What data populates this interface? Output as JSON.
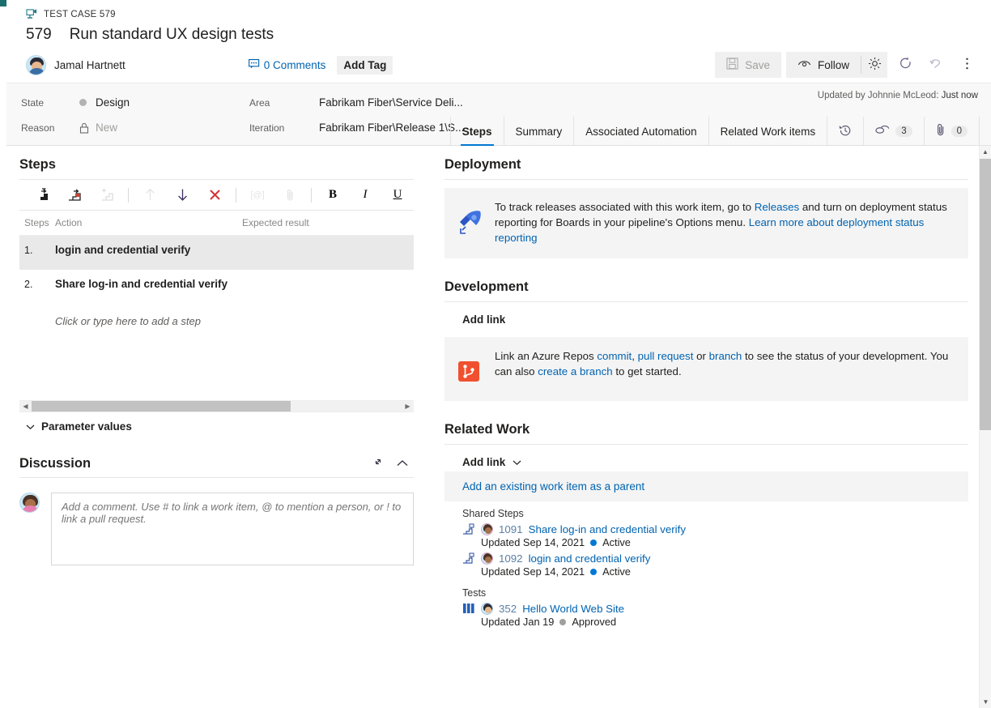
{
  "header": {
    "breadcrumb": "TEST CASE 579",
    "work_item_id": "579",
    "title": "Run standard UX design tests",
    "assignee": "Jamal Hartnett",
    "comments_label": "0 Comments",
    "add_tag_label": "Add Tag",
    "save_label": "Save",
    "follow_label": "Follow",
    "updated_by": "Updated by Johnnie McLeod:",
    "updated_when": "Just now"
  },
  "fields": {
    "state_label": "State",
    "state_value": "Design",
    "reason_label": "Reason",
    "reason_value": "New",
    "area_label": "Area",
    "area_value": "Fabrikam Fiber\\Service Deli...",
    "iteration_label": "Iteration",
    "iteration_value": "Fabrikam Fiber\\Release 1\\S..."
  },
  "tabs": [
    {
      "label": "Steps",
      "active": true
    },
    {
      "label": "Summary",
      "active": false
    },
    {
      "label": "Associated Automation",
      "active": false
    },
    {
      "label": "Related Work items",
      "active": false
    }
  ],
  "tab_icons": {
    "history_icon": "history-icon",
    "links_icon": "links-icon",
    "links_count": "3",
    "attachments_icon": "attachment-icon",
    "attachments_count": "0"
  },
  "steps": {
    "section_title": "Steps",
    "toolbar": [
      {
        "name": "insert-step-icon",
        "enabled": true
      },
      {
        "name": "insert-shared-step-icon",
        "enabled": true
      },
      {
        "name": "create-shared-step-icon",
        "enabled": false
      },
      {
        "name": "move-up-icon",
        "enabled": false
      },
      {
        "name": "move-down-icon",
        "enabled": true
      },
      {
        "name": "delete-icon",
        "enabled": true
      },
      {
        "name": "mention-icon",
        "enabled": false
      },
      {
        "name": "attach-icon",
        "enabled": false
      },
      {
        "name": "bold-icon",
        "enabled": true
      },
      {
        "name": "italic-icon",
        "enabled": true
      },
      {
        "name": "underline-icon",
        "enabled": true
      }
    ],
    "columns": {
      "steps": "Steps",
      "action": "Action",
      "expected": "Expected result"
    },
    "rows": [
      {
        "num": "1.",
        "action": "login and credential verify",
        "expected": "",
        "selected": true
      },
      {
        "num": "2.",
        "action": "Share log-in and credential verify",
        "expected": "",
        "selected": false
      }
    ],
    "add_step_hint": "Click or type here to add a step",
    "parameter_values_label": "Parameter values"
  },
  "discussion": {
    "title": "Discussion",
    "placeholder": "Add a comment. Use # to link a work item, @ to mention a person, or ! to link a pull request."
  },
  "deployment": {
    "title": "Deployment",
    "text_1": "To track releases associated with this work item, go to ",
    "link_releases": "Releases",
    "text_2": " and turn on deployment status reporting for Boards in your pipeline's Options menu. ",
    "link_learn": "Learn more about deployment status reporting"
  },
  "development": {
    "title": "Development",
    "add_link_label": "Add link",
    "text_1": "Link an Azure Repos ",
    "link_commit": "commit",
    "text_sep1": ", ",
    "link_pr": "pull request",
    "text_2": " or ",
    "link_branch": "branch",
    "text_3": " to see the status of your development. You can also ",
    "link_create_branch": "create a branch",
    "text_4": " to get started."
  },
  "related_work": {
    "title": "Related Work",
    "add_link_label": "Add link",
    "parent_banner": "Add an existing work item as a parent",
    "groups": [
      {
        "label": "Shared Steps",
        "items": [
          {
            "icon": "shared-steps-icon",
            "id": "1091",
            "name": "Share log-in and credential verify",
            "updated": "Updated Sep 14, 2021",
            "status": "Active",
            "status_color": "#0078d4"
          },
          {
            "icon": "shared-steps-icon",
            "id": "1092",
            "name": "login and credential verify",
            "updated": "Updated Sep 14, 2021",
            "status": "Active",
            "status_color": "#0078d4"
          }
        ]
      },
      {
        "label": "Tests",
        "items": [
          {
            "icon": "test-plan-icon",
            "id": "352",
            "name": "Hello World Web Site",
            "updated": "Updated Jan 19",
            "status": "Approved",
            "status_color": "#a19f9d"
          }
        ]
      }
    ]
  },
  "colors": {
    "accent_bar": "#1a6e6e",
    "active_tab": "#0078d4",
    "link": "#0063b1",
    "delete": "#d13438"
  }
}
